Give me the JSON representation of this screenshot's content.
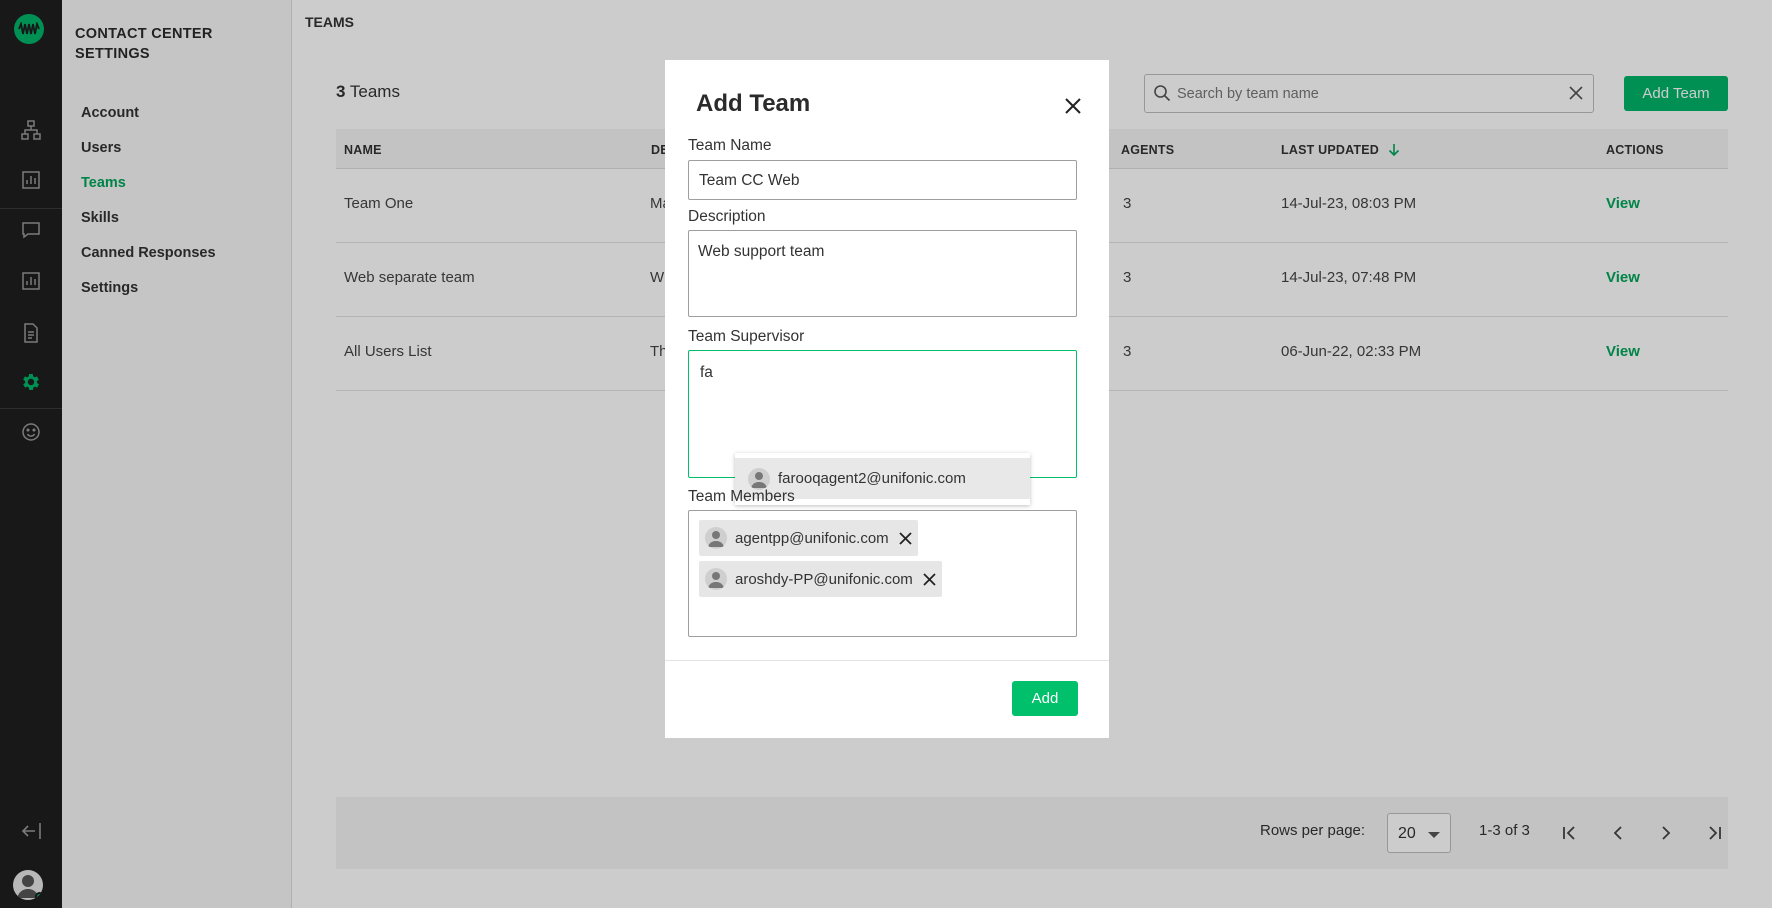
{
  "sidebar": {
    "title_line1": "CONTACT CENTER",
    "title_line2": "SETTINGS",
    "items": [
      {
        "label": "Account"
      },
      {
        "label": "Users"
      },
      {
        "label": "Teams"
      },
      {
        "label": "Skills"
      },
      {
        "label": "Canned Responses"
      },
      {
        "label": "Settings"
      }
    ],
    "active_item": "Teams"
  },
  "header": {
    "breadcrumb": "TEAMS"
  },
  "summary": {
    "count": "3",
    "count_suffix": " Teams"
  },
  "search": {
    "placeholder": "Search by team name",
    "value": ""
  },
  "toolbar": {
    "add_team_label": "Add Team"
  },
  "table": {
    "columns": [
      "NAME",
      "DE",
      "AGENTS",
      "LAST UPDATED",
      "ACTIONS"
    ],
    "sorted_column": "LAST UPDATED",
    "rows": [
      {
        "name": "Team One",
        "desc": "Ma",
        "agents": "3",
        "updated": "14-Jul-23, 08:03 PM",
        "action": "View"
      },
      {
        "name": "Web separate team",
        "desc": "W",
        "agents": "3",
        "updated": "14-Jul-23, 07:48 PM",
        "action": "View"
      },
      {
        "name": "All Users List",
        "desc": "Th",
        "agents": "3",
        "updated": "06-Jun-22, 02:33 PM",
        "action": "View"
      }
    ]
  },
  "pagination": {
    "rows_per_page_label": "Rows per page:",
    "rows_per_page": "20",
    "range": "1-3 of 3"
  },
  "modal": {
    "title": "Add Team",
    "team_name_label": "Team Name",
    "team_name_value": "Team CC Web",
    "description_label": "Description",
    "description_value": "Web support team",
    "supervisor_label": "Team Supervisor",
    "supervisor_query": "fa",
    "supervisor_suggestion": "farooqagent2@unifonic.com",
    "members_label": "Team Members",
    "members": [
      "agentpp@unifonic.com",
      "aroshdy-PP@unifonic.com"
    ],
    "add_label": "Add"
  },
  "colors": {
    "brand_green": "#00b56a",
    "rail_bg": "#1e1e1e",
    "focus_green": "#00c06b"
  }
}
